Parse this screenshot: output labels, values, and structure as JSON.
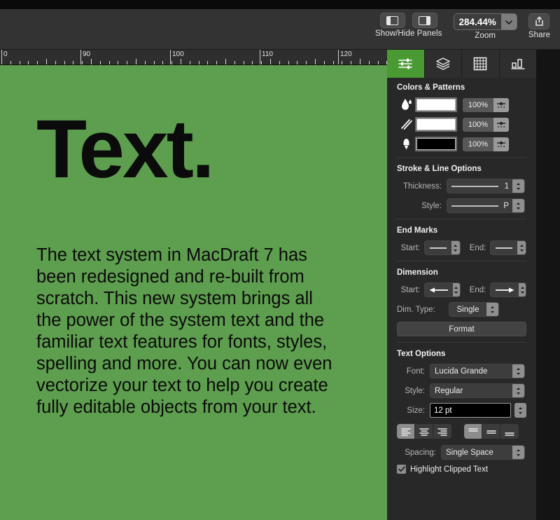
{
  "toolbar": {
    "panels": {
      "label": "Show/Hide Panels",
      "left_icon": "panel-left-icon",
      "right_icon": "panel-right-icon"
    },
    "zoom": {
      "label": "Zoom",
      "value": "284.44%",
      "dropdown_icon": "chevron-down-icon"
    },
    "share": {
      "label": "Share",
      "icon": "share-icon"
    }
  },
  "ruler": {
    "labels": [
      "0",
      "90",
      "100",
      "110",
      "120"
    ],
    "positions": [
      2,
      115,
      243,
      371,
      483
    ]
  },
  "canvas": {
    "background": "#5e9e4f",
    "title": "Text.",
    "body": "The text system in MacDraft 7 has been redesigned and re-built from scratch. This new system brings all the power of the system text and the familiar text features for fonts, styles, spelling and more. You can now even vectorize your text to help you create fully editable objects from your text."
  },
  "inspector": {
    "accent": "#4a9a33",
    "tabs": [
      {
        "name": "tab-attributes",
        "icon": "sliders-icon",
        "active": true
      },
      {
        "name": "tab-layers",
        "icon": "layers-icon",
        "active": false
      },
      {
        "name": "tab-grid",
        "icon": "grid-icon",
        "active": false
      },
      {
        "name": "tab-chart",
        "icon": "chart-icon",
        "active": false
      }
    ],
    "colors_patterns": {
      "title": "Colors & Patterns",
      "rows": [
        {
          "icon": "fill-droplet-icon",
          "swatch": "#ffffff",
          "opacity": "100%",
          "menu_icon": "pattern-menu-icon"
        },
        {
          "icon": "pattern-lines-icon",
          "swatch": "#ffffff",
          "opacity": "100%",
          "menu_icon": "pattern-menu-icon"
        },
        {
          "icon": "pen-nib-icon",
          "swatch": "#000000",
          "opacity": "100%",
          "menu_icon": "pattern-menu-icon"
        }
      ]
    },
    "stroke": {
      "title": "Stroke & Line Options",
      "thickness_label": "Thickness:",
      "thickness_value": "1",
      "style_label": "Style:",
      "style_value": "P"
    },
    "end_marks": {
      "title": "End Marks",
      "start_label": "Start:",
      "start_icon": "plain-line-icon",
      "end_label": "End:",
      "end_icon": "plain-line-icon"
    },
    "dimension": {
      "title": "Dimension",
      "start_label": "Start:",
      "start_icon": "arrow-left-icon",
      "end_label": "End:",
      "end_icon": "arrow-right-icon",
      "dim_type_label": "Dim. Type:",
      "dim_type_value": "Single",
      "format_button": "Format"
    },
    "text_options": {
      "title": "Text Options",
      "font_label": "Font:",
      "font_value": "Lucida Grande",
      "style_label": "Style:",
      "style_value": "Regular",
      "size_label": "Size:",
      "size_value": "12 pt",
      "align_horizontal": [
        {
          "name": "align-left-button",
          "icon": "align-left-icon",
          "active": true
        },
        {
          "name": "align-center-button",
          "icon": "align-center-icon",
          "active": false
        },
        {
          "name": "align-right-button",
          "icon": "align-right-icon",
          "active": false
        }
      ],
      "align_vertical": [
        {
          "name": "valign-top-button",
          "icon": "valign-top-icon",
          "active": true
        },
        {
          "name": "valign-middle-button",
          "icon": "valign-middle-icon",
          "active": false
        },
        {
          "name": "valign-bottom-button",
          "icon": "valign-bottom-icon",
          "active": false
        }
      ],
      "spacing_label": "Spacing:",
      "spacing_value": "Single Space",
      "highlight_clipped_label": "Highlight Clipped Text",
      "highlight_clipped_checked": true
    }
  }
}
